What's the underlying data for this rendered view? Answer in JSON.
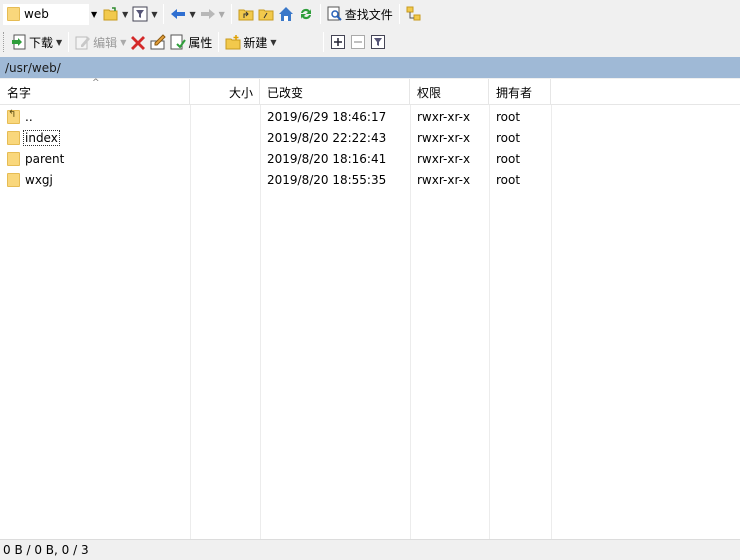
{
  "toolbar_top": {
    "location_combo": {
      "value": "web",
      "icon": "folder-icon"
    },
    "find_files_label": "查找文件"
  },
  "toolbar_bottom": {
    "download_label": "下载",
    "edit_label": "编辑",
    "properties_label": "属性",
    "new_label": "新建"
  },
  "path": "/usr/web/",
  "columns": {
    "name": "名字",
    "size": "大小",
    "modified": "已改变",
    "permissions": "权限",
    "owner": "拥有者"
  },
  "files": [
    {
      "name": "..",
      "size": "",
      "modified": "2019/6/29 18:46:17",
      "permissions": "rwxr-xr-x",
      "owner": "root",
      "icon": "parent-folder-icon"
    },
    {
      "name": "index",
      "size": "",
      "modified": "2019/8/20 22:22:43",
      "permissions": "rwxr-xr-x",
      "owner": "root",
      "icon": "folder-icon"
    },
    {
      "name": "parent",
      "size": "",
      "modified": "2019/8/20 18:16:41",
      "permissions": "rwxr-xr-x",
      "owner": "root",
      "icon": "folder-icon"
    },
    {
      "name": "wxgj",
      "size": "",
      "modified": "2019/8/20 18:55:35",
      "permissions": "rwxr-xr-x",
      "owner": "root",
      "icon": "folder-icon"
    }
  ],
  "status": "0 B / 0 B,  0 / 3",
  "colors": {
    "path_bar": "#9fb9d6",
    "folder": "#f9d77c"
  }
}
